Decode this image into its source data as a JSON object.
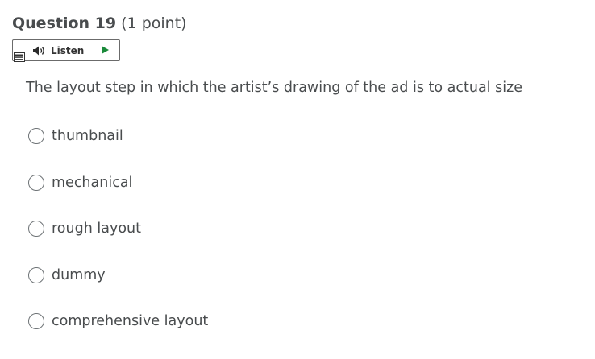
{
  "question": {
    "title": "Question 19",
    "points": "(1 point)",
    "text": "The layout step in which the artist’s drawing of the ad is to actual size"
  },
  "listen": {
    "label": "Listen",
    "icons": {
      "menu": "menu-icon",
      "speaker": "speaker-icon",
      "play": "play-icon"
    },
    "play_color": "#1a8a3a"
  },
  "options": [
    {
      "label": "thumbnail",
      "selected": false
    },
    {
      "label": "mechanical",
      "selected": false
    },
    {
      "label": "rough layout",
      "selected": false
    },
    {
      "label": "dummy",
      "selected": false
    },
    {
      "label": "comprehensive layout",
      "selected": false
    }
  ]
}
